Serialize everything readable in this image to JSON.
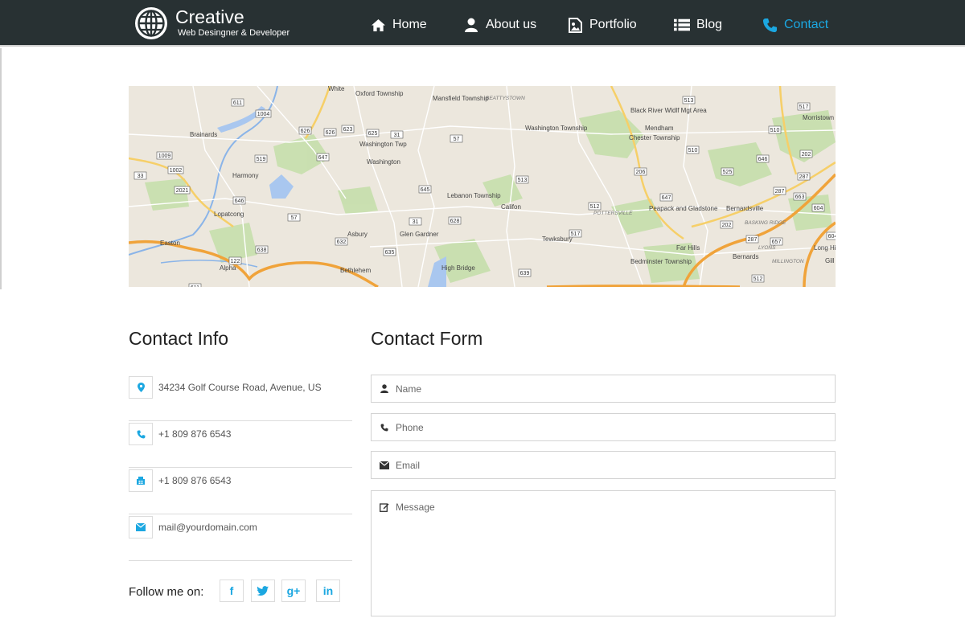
{
  "brand": {
    "name": "Creative",
    "tagline": "Web Desingner & Developer"
  },
  "nav": [
    {
      "label": "Home",
      "icon": "home-icon"
    },
    {
      "label": "About us",
      "icon": "user-icon"
    },
    {
      "label": "Portfolio",
      "icon": "picture-icon"
    },
    {
      "label": "Blog",
      "icon": "list-icon"
    },
    {
      "label": "Contact",
      "icon": "phone-icon",
      "active": true
    }
  ],
  "colors": {
    "header_bg": "#283133",
    "accent": "#1ba7e1",
    "border": "#dcdcdc"
  },
  "map": {
    "places": [
      "White",
      "Oxford Township",
      "Mansfield Township",
      "BEATTYSTOWN",
      "Black River Wldlf Mgt Area",
      "Mendham",
      "Morristown",
      "Brainards",
      "Washington Township",
      "Chester Township",
      "Harmony",
      "Washington Twp",
      "Washington",
      "Lebanon Township",
      "Califon",
      "POTTERSVILLE",
      "Peapack and Gladstone",
      "Bernardsville",
      "Lopatcong",
      "BASKING RIDGE",
      "Asbury",
      "Glen Gardner",
      "Tewksbury",
      "Far Hills",
      "Easton",
      "LYONS",
      "Long Hill",
      "Bernards",
      "MILLINGTON",
      "Gill",
      "Alpha",
      "Bethlehem",
      "High Bridge",
      "Bedminster Township"
    ],
    "shields": [
      "611",
      "1004",
      "626",
      "626",
      "623",
      "625",
      "31",
      "1009",
      "1002",
      "519",
      "647",
      "57",
      "513",
      "2021",
      "646",
      "645",
      "628",
      "512",
      "57",
      "31",
      "632",
      "635",
      "517",
      "638",
      "122",
      "611",
      "639",
      "510",
      "517",
      "513",
      "510",
      "646",
      "206",
      "525",
      "647",
      "202",
      "287",
      "663",
      "604",
      "657",
      "604",
      "512",
      "202",
      "287",
      "287",
      "33"
    ]
  },
  "contact_info": {
    "heading": "Contact Info",
    "items": [
      {
        "icon": "map-marker-icon",
        "text": "34234 Golf Course Road, Avenue, US"
      },
      {
        "icon": "phone-icon",
        "text": "+1 809 876 6543"
      },
      {
        "icon": "fax-icon",
        "text": "+1 809 876 6543"
      },
      {
        "icon": "envelope-icon",
        "text": "mail@yourdomain.com"
      }
    ],
    "follow_label": "Follow me on:",
    "social": [
      {
        "icon": "facebook-icon",
        "label": "f"
      },
      {
        "icon": "twitter-icon",
        "label": "t"
      },
      {
        "icon": "google-plus-icon",
        "label": "g+"
      },
      {
        "icon": "linkedin-icon",
        "label": "in"
      }
    ]
  },
  "contact_form": {
    "heading": "Contact Form",
    "name_placeholder": "Name",
    "phone_placeholder": "Phone",
    "email_placeholder": "Email",
    "message_placeholder": "Message"
  }
}
